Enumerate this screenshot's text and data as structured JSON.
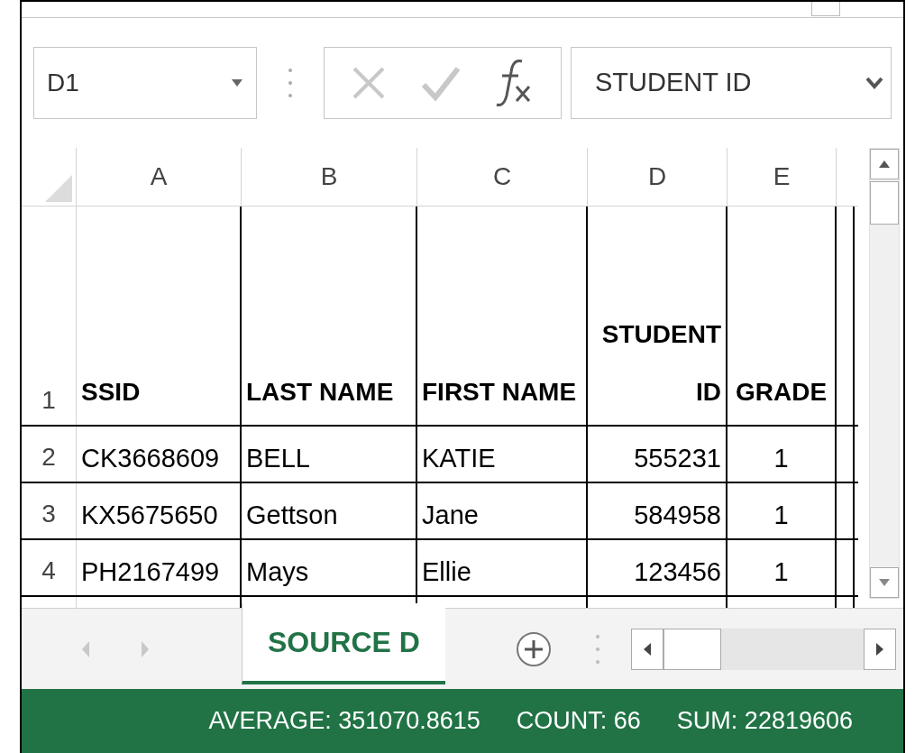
{
  "name_box": {
    "value": "D1"
  },
  "formula_bar": {
    "value": "STUDENT ID"
  },
  "columns": [
    "A",
    "B",
    "C",
    "D",
    "E"
  ],
  "rows": [
    {
      "number": "1",
      "kind": "header",
      "cells": [
        "SSID",
        "LAST NAME",
        "FIRST NAME",
        "STUDENT ID",
        "GRADE"
      ]
    },
    {
      "number": "2",
      "kind": "data",
      "cells": [
        "CK3668609",
        "BELL",
        "KATIE",
        "555231",
        "1"
      ]
    },
    {
      "number": "3",
      "kind": "data",
      "cells": [
        "KX5675650",
        "Gettson",
        "Jane",
        "584958",
        "1"
      ]
    },
    {
      "number": "4",
      "kind": "data",
      "cells": [
        "PH2167499",
        "Mays",
        "Ellie",
        "123456",
        "1"
      ]
    }
  ],
  "sheet_tabs": [
    {
      "label": "SOURCE D",
      "selected": true
    }
  ],
  "status_bar": [
    "AVERAGE: 351070.8615",
    "COUNT: 66",
    "SUM: 22819606"
  ]
}
